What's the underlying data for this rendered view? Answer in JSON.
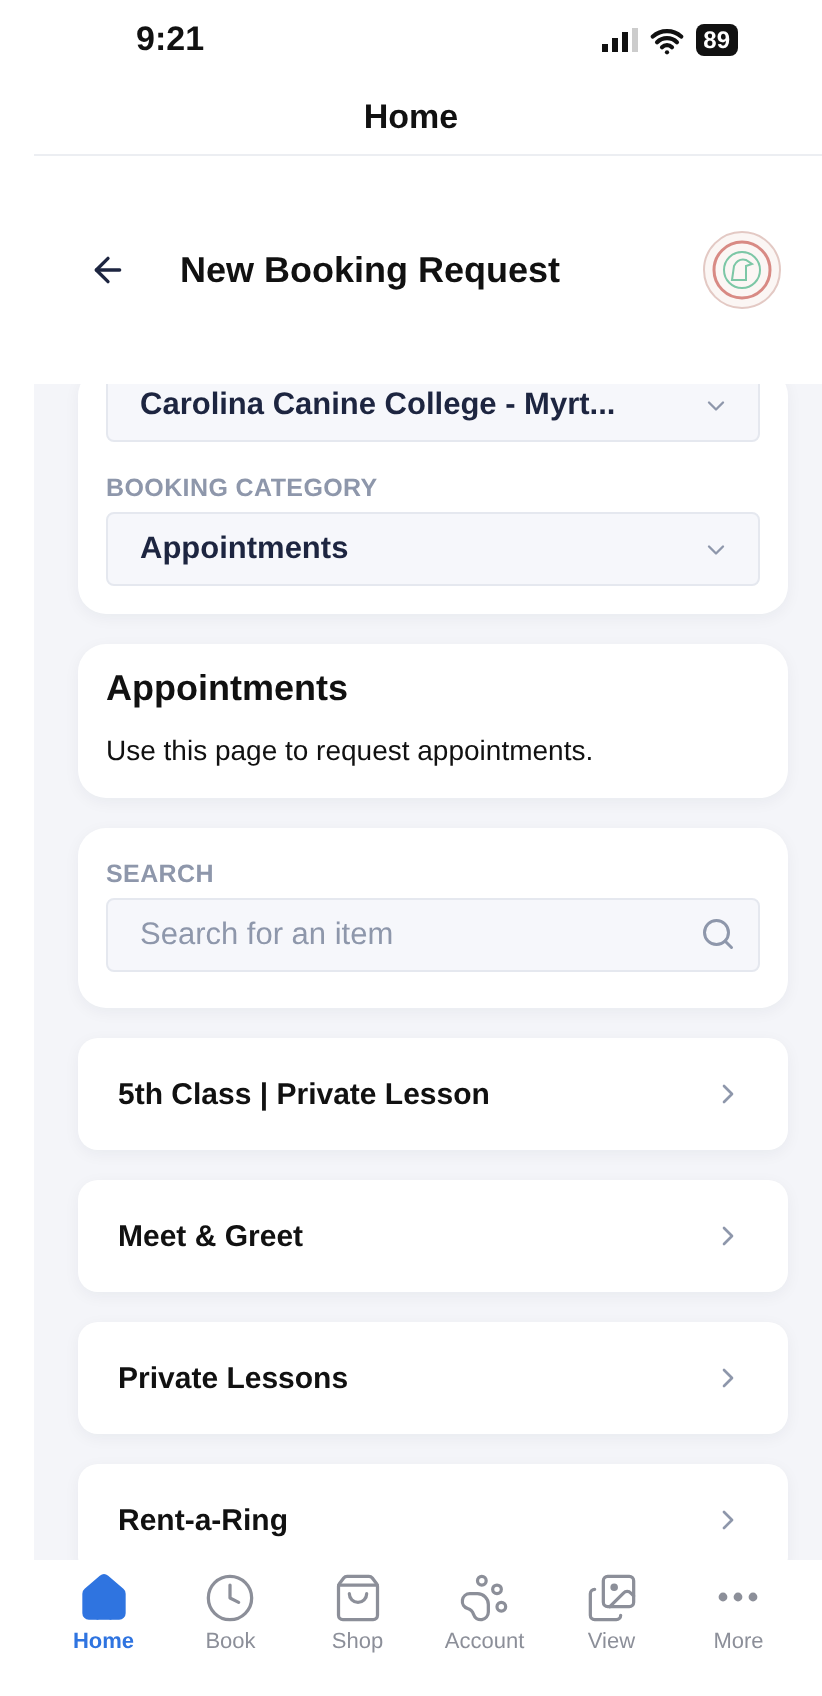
{
  "status_bar": {
    "time": "9:21",
    "battery": "89"
  },
  "nav_bar": {
    "title": "Home"
  },
  "page_header": {
    "title": "New Booking Request"
  },
  "filters": {
    "location": {
      "value": "Carolina Canine College - Myrt..."
    },
    "category": {
      "label": "BOOKING CATEGORY",
      "value": "Appointments"
    }
  },
  "info": {
    "title": "Appointments",
    "description": "Use this page to request appointments."
  },
  "search": {
    "label": "SEARCH",
    "placeholder": "Search for an item"
  },
  "items": [
    {
      "label": "5th Class | Private Lesson"
    },
    {
      "label": "Meet & Greet"
    },
    {
      "label": "Private Lessons"
    },
    {
      "label": "Rent-a-Ring"
    }
  ],
  "tabs": [
    {
      "label": "Home",
      "selected": true
    },
    {
      "label": "Book",
      "selected": false
    },
    {
      "label": "Shop",
      "selected": false
    },
    {
      "label": "Account",
      "selected": false
    },
    {
      "label": "View",
      "selected": false
    },
    {
      "label": "More",
      "selected": false
    }
  ]
}
